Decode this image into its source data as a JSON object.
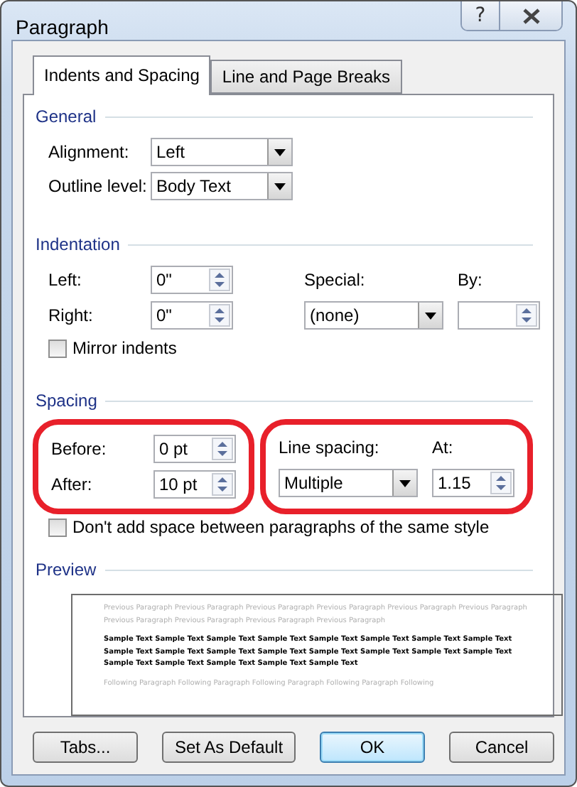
{
  "window": {
    "title": "Paragraph",
    "help_button": "?"
  },
  "tabs": [
    {
      "label": "Indents and Spacing",
      "selected": true
    },
    {
      "label": "Line and Page Breaks",
      "selected": false
    }
  ],
  "general": {
    "title": "General",
    "fields": [
      {
        "label": "Alignment:",
        "value": "Left"
      },
      {
        "label": "Outline level:",
        "value": "Body Text"
      }
    ]
  },
  "indentation": {
    "title": "Indentation",
    "left": {
      "label": "Left:",
      "value": "0\""
    },
    "right": {
      "label": "Right:",
      "value": "0\""
    },
    "special": {
      "label": "Special:",
      "value": "(none)"
    },
    "by": {
      "label": "By:"
    },
    "mirror": {
      "label": "Mirror indents",
      "checked": false
    }
  },
  "spacing": {
    "title": "Spacing",
    "before": {
      "label": "Before:",
      "value": "0 pt"
    },
    "after": {
      "label": "After:",
      "value": "10 pt"
    },
    "line_spacing": {
      "label": "Line spacing:",
      "value": "Multiple"
    },
    "at": {
      "label": "At:",
      "value": "1.15"
    },
    "dont_add": {
      "label": "Don't add space between paragraphs of the same style",
      "checked": false
    },
    "highlights": [
      {
        "kind": "ellipse",
        "color": "#e8202a"
      },
      {
        "kind": "ellipse",
        "color": "#e8202a"
      }
    ]
  },
  "preview": {
    "title": "Preview",
    "paragraphs": [
      {
        "kind": "previous",
        "text": "Previous Paragraph Previous Paragraph Previous Paragraph Previous Paragraph Previous Paragraph Previous Paragraph Previous Paragraph Previous Paragraph Previous Paragraph Previous Paragraph"
      },
      {
        "kind": "sample",
        "text": "Sample Text Sample Text Sample Text Sample Text Sample Text Sample Text Sample Text Sample Text Sample Text Sample Text Sample Text Sample Text Sample Text Sample Text Sample Text Sample Text Sample Text Sample Text Sample Text Sample Text Sample Text"
      },
      {
        "kind": "following",
        "text": "Following Paragraph Following Paragraph Following Paragraph Following Paragraph Following"
      }
    ]
  },
  "buttons": [
    {
      "label": "Tabs...",
      "default": false
    },
    {
      "label": "Set As Default",
      "default": false
    },
    {
      "label": "OK",
      "default": true
    },
    {
      "label": "Cancel",
      "default": false
    }
  ]
}
